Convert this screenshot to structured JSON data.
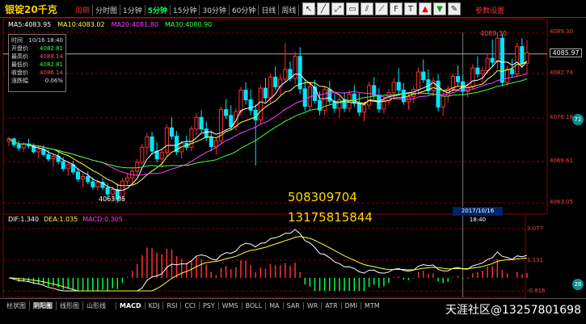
{
  "header": {
    "title": "银锭20千克",
    "periods": [
      "周期",
      "分时图",
      "1分钟",
      "5分钟",
      "15分钟",
      "30分钟",
      "60分钟",
      "日线",
      "周线",
      "月线"
    ],
    "active_period": "5分钟",
    "tools": [
      "cursor-icon",
      "line-icon",
      "ray-icon",
      "rect-icon",
      "parallel-icon",
      "fan-icon",
      "fib-icon",
      "text-icon",
      "up-arrow-icon",
      "down-arrow-icon",
      "delete-icon"
    ],
    "settings_label": "参数设置"
  },
  "ma_legend": [
    {
      "label": "MA5:4083.95",
      "color": "#ffffff"
    },
    {
      "label": "MA10:4083.02",
      "color": "#ffff40"
    },
    {
      "label": "MA20:4081.80",
      "color": "#ff40ff"
    },
    {
      "label": "MA30:4080.90",
      "color": "#40ff40"
    }
  ],
  "info": {
    "rows": [
      {
        "k": "时间",
        "v": "10/16 18:40",
        "c": ""
      },
      {
        "k": "开盘价",
        "v": "4082.81",
        "c": "green"
      },
      {
        "k": "最高价",
        "v": "4088.14",
        "c": "red"
      },
      {
        "k": "最低价",
        "v": "4082.81",
        "c": "green"
      },
      {
        "k": "收盘价",
        "v": "4086.14",
        "c": "red"
      },
      {
        "k": "涨跌幅",
        "v": "0.06%",
        "c": ""
      }
    ]
  },
  "price_axis": {
    "ticks": [
      "4089.30",
      "4082.74",
      "4076.18",
      "4069.61",
      "4063.05"
    ],
    "current": "4085.97"
  },
  "annotations": {
    "high_label": "4089.30",
    "low_label": "4063.05",
    "date_tag": "2017/10/16 18:40"
  },
  "macd_legend": [
    {
      "label": "DIF:1.340",
      "color": "#ffffff"
    },
    {
      "label": "DEA:1.035",
      "color": "#ffff40"
    },
    {
      "label": "MACD:0.305",
      "color": "#ff40ff"
    }
  ],
  "macd_axis": {
    "ticks": [
      "3.077",
      "1.131",
      "-0.816"
    ]
  },
  "watermarks": {
    "qq": "508309704",
    "phone": "13175815844",
    "footer": "天涯社区@13257801698"
  },
  "bottom_tabs": [
    "柱状图",
    "阴阳图",
    "线形图",
    "山形线",
    "MACD",
    "KDJ",
    "RSI",
    "CCI",
    "PSY",
    "WMS",
    "BOLL",
    "MA",
    "SAR",
    "WR",
    "ATR",
    "DMI",
    "MTM"
  ],
  "bottom_active": [
    "阴阳图",
    "MACD"
  ],
  "colors": {
    "up": "#ff3030",
    "down": "#00e5ff",
    "grid": "#8a0000"
  },
  "chart_data": {
    "type": "candlestick",
    "ylim": [
      4063.05,
      4089.3
    ],
    "candles": [
      [
        4072.5,
        4073.2,
        4071.8,
        4072.9
      ],
      [
        4072.9,
        4073.1,
        4071.6,
        4072.0
      ],
      [
        4072.0,
        4072.6,
        4071.0,
        4071.5
      ],
      [
        4071.5,
        4072.4,
        4070.9,
        4072.1
      ],
      [
        4072.1,
        4072.9,
        4071.4,
        4071.8
      ],
      [
        4071.8,
        4072.2,
        4070.6,
        4070.9
      ],
      [
        4070.9,
        4071.8,
        4069.9,
        4071.3
      ],
      [
        4071.3,
        4071.9,
        4070.2,
        4070.5
      ],
      [
        4070.5,
        4071.2,
        4069.4,
        4069.8
      ],
      [
        4069.8,
        4070.6,
        4068.6,
        4070.2
      ],
      [
        4070.2,
        4070.9,
        4069.0,
        4069.4
      ],
      [
        4069.4,
        4070.1,
        4067.9,
        4068.3
      ],
      [
        4068.3,
        4069.2,
        4067.2,
        4068.9
      ],
      [
        4068.9,
        4069.5,
        4067.4,
        4067.8
      ],
      [
        4067.8,
        4068.4,
        4066.3,
        4066.7
      ],
      [
        4066.7,
        4067.6,
        4065.4,
        4067.1
      ],
      [
        4067.1,
        4067.9,
        4065.9,
        4066.3
      ],
      [
        4066.3,
        4067.0,
        4065.1,
        4065.5
      ],
      [
        4065.5,
        4066.6,
        4064.9,
        4066.2
      ],
      [
        4066.2,
        4066.9,
        4065.0,
        4065.4
      ],
      [
        4065.4,
        4066.1,
        4063.9,
        4064.4
      ],
      [
        4064.4,
        4065.6,
        4063.5,
        4065.1
      ],
      [
        4065.1,
        4066.0,
        4063.05,
        4063.6
      ],
      [
        4063.6,
        4066.8,
        4063.3,
        4066.4
      ],
      [
        4066.4,
        4067.5,
        4065.8,
        4066.9
      ],
      [
        4066.9,
        4068.4,
        4066.1,
        4067.9
      ],
      [
        4067.9,
        4069.8,
        4067.2,
        4069.3
      ],
      [
        4069.3,
        4072.1,
        4068.8,
        4071.6
      ],
      [
        4071.6,
        4073.8,
        4070.4,
        4073.2
      ],
      [
        4073.2,
        4074.0,
        4070.6,
        4071.0
      ],
      [
        4071.0,
        4072.4,
        4069.2,
        4069.8
      ],
      [
        4069.8,
        4071.3,
        4068.5,
        4070.8
      ],
      [
        4070.8,
        4075.1,
        4070.2,
        4074.6
      ],
      [
        4074.6,
        4076.2,
        4072.8,
        4073.3
      ],
      [
        4073.3,
        4074.1,
        4070.4,
        4070.9
      ],
      [
        4070.9,
        4072.6,
        4069.9,
        4072.2
      ],
      [
        4072.2,
        4073.4,
        4071.1,
        4071.6
      ],
      [
        4071.6,
        4074.9,
        4071.0,
        4074.4
      ],
      [
        4074.4,
        4076.8,
        4073.5,
        4076.2
      ],
      [
        4076.2,
        4077.3,
        4073.8,
        4074.4
      ],
      [
        4074.4,
        4075.6,
        4072.6,
        4073.1
      ],
      [
        4073.1,
        4074.2,
        4071.0,
        4071.7
      ],
      [
        4071.7,
        4073.0,
        4070.5,
        4072.6
      ],
      [
        4072.6,
        4077.9,
        4072.0,
        4077.4
      ],
      [
        4077.4,
        4079.0,
        4075.9,
        4076.5
      ],
      [
        4076.5,
        4078.1,
        4074.2,
        4074.8
      ],
      [
        4074.8,
        4077.6,
        4074.1,
        4077.1
      ],
      [
        4077.1,
        4080.9,
        4076.5,
        4080.4
      ],
      [
        4080.4,
        4081.6,
        4078.2,
        4078.9
      ],
      [
        4078.9,
        4080.5,
        4076.6,
        4077.3
      ],
      [
        4077.3,
        4078.2,
        4068.8,
        4075.8
      ],
      [
        4075.8,
        4081.2,
        4075.1,
        4080.7
      ],
      [
        4080.7,
        4082.3,
        4078.6,
        4079.2
      ],
      [
        4079.2,
        4082.9,
        4078.5,
        4082.4
      ],
      [
        4082.4,
        4084.1,
        4080.4,
        4080.9
      ],
      [
        4080.9,
        4082.8,
        4079.6,
        4082.1
      ],
      [
        4082.1,
        4087.6,
        4081.5,
        4083.6
      ],
      [
        4083.6,
        4084.8,
        4081.7,
        4082.2
      ],
      [
        4082.2,
        4086.3,
        4081.3,
        4085.6
      ],
      [
        4085.6,
        4087.0,
        4079.8,
        4080.6
      ],
      [
        4080.6,
        4082.1,
        4077.2,
        4077.9
      ],
      [
        4077.9,
        4081.7,
        4077.3,
        4080.9
      ],
      [
        4080.9,
        4082.0,
        4078.3,
        4078.8
      ],
      [
        4078.8,
        4080.2,
        4076.5,
        4077.3
      ],
      [
        4077.3,
        4081.1,
        4076.6,
        4080.5
      ],
      [
        4080.5,
        4081.8,
        4078.1,
        4078.7
      ],
      [
        4078.7,
        4079.8,
        4076.9,
        4077.6
      ],
      [
        4077.6,
        4079.5,
        4076.2,
        4078.9
      ],
      [
        4078.9,
        4080.1,
        4077.0,
        4077.6
      ],
      [
        4077.6,
        4080.4,
        4077.0,
        4079.8
      ],
      [
        4079.8,
        4081.2,
        4077.8,
        4078.4
      ],
      [
        4078.4,
        4079.9,
        4076.4,
        4077.0
      ],
      [
        4077.0,
        4078.6,
        4075.6,
        4078.1
      ],
      [
        4078.1,
        4081.7,
        4077.4,
        4081.1
      ],
      [
        4081.1,
        4082.4,
        4079.0,
        4079.6
      ],
      [
        4079.6,
        4080.7,
        4076.9,
        4077.5
      ],
      [
        4077.5,
        4079.4,
        4076.8,
        4078.8
      ],
      [
        4078.8,
        4080.6,
        4078.1,
        4080.0
      ],
      [
        4080.0,
        4082.3,
        4079.2,
        4081.6
      ],
      [
        4081.6,
        4083.8,
        4079.8,
        4080.4
      ],
      [
        4080.4,
        4081.5,
        4078.1,
        4078.6
      ],
      [
        4078.6,
        4080.0,
        4077.4,
        4079.4
      ],
      [
        4079.4,
        4081.0,
        4078.4,
        4080.5
      ],
      [
        4080.5,
        4083.9,
        4079.7,
        4083.2
      ],
      [
        4083.2,
        4085.1,
        4081.5,
        4082.0
      ],
      [
        4082.0,
        4083.6,
        4079.7,
        4080.3
      ],
      [
        4080.3,
        4082.4,
        4079.4,
        4081.8
      ],
      [
        4081.8,
        4082.9,
        4077.1,
        4077.8
      ],
      [
        4077.8,
        4080.2,
        4076.4,
        4079.5
      ],
      [
        4079.5,
        4081.1,
        4078.5,
        4080.6
      ],
      [
        4080.6,
        4083.0,
        4079.9,
        4082.5
      ],
      [
        4082.5,
        4084.2,
        4081.1,
        4081.7
      ],
      [
        4081.7,
        4082.8,
        4079.6,
        4080.2
      ],
      [
        4080.2,
        4081.6,
        4079.3,
        4081.0
      ],
      [
        4081.0,
        4084.4,
        4080.4,
        4083.8
      ],
      [
        4083.8,
        4085.6,
        4082.3,
        4082.9
      ],
      [
        4082.9,
        4084.0,
        4081.6,
        4083.4
      ],
      [
        4083.4,
        4086.0,
        4082.8,
        4085.3
      ],
      [
        4085.3,
        4088.2,
        4084.1,
        4084.7
      ],
      [
        4084.7,
        4089.3,
        4083.7,
        4088.4
      ],
      [
        4088.4,
        4089.1,
        4081.0,
        4081.6
      ],
      [
        4081.6,
        4084.1,
        4081.0,
        4083.6
      ],
      [
        4083.6,
        4085.2,
        4082.4,
        4082.9
      ],
      [
        4082.9,
        4087.7,
        4082.3,
        4087.1
      ],
      [
        4087.1,
        4088.4,
        4083.9,
        4084.5
      ],
      [
        4084.5,
        4088.14,
        4082.81,
        4086.14
      ]
    ]
  }
}
